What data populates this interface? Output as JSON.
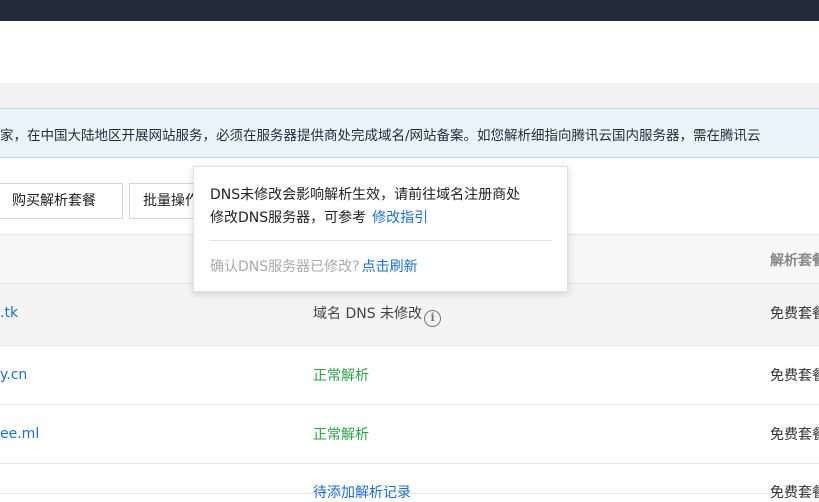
{
  "notice": {
    "text": "家，在中国大陆地区开展网站服务，必须在服务器提供商处完成域名/网站备案。如您解析细指向腾讯云国内服务器，需在腾讯云"
  },
  "toolbar": {
    "buy_label": "购买解析套餐",
    "batch_label": "批量操作"
  },
  "table": {
    "header_plan": "解析套餐"
  },
  "rows": [
    {
      "domain": ".tk",
      "status": "域名 DNS 未修改",
      "status_type": "warn",
      "plan": "免费套餐"
    },
    {
      "domain": "y.cn",
      "status": "正常解析",
      "status_type": "ok",
      "plan": "免费套餐"
    },
    {
      "domain": "ee.ml",
      "status": "正常解析",
      "status_type": "ok",
      "plan": "免费套餐"
    },
    {
      "domain": "",
      "status": "待添加解析记录",
      "status_type": "link",
      "plan": "免费套餐"
    }
  ],
  "popover": {
    "line1": "DNS未修改会影响解析生效，请前往域名注册商处",
    "line2": "修改DNS服务器，可参考",
    "guide_link": "修改指引",
    "confirm_text": "确认DNS服务器已修改?",
    "refresh_link": "点击刷新"
  },
  "colors": {
    "link": "#1a6fd8",
    "ok": "#29a645",
    "topbar": "#232b3a",
    "notice_bg": "#eaf4fd"
  }
}
